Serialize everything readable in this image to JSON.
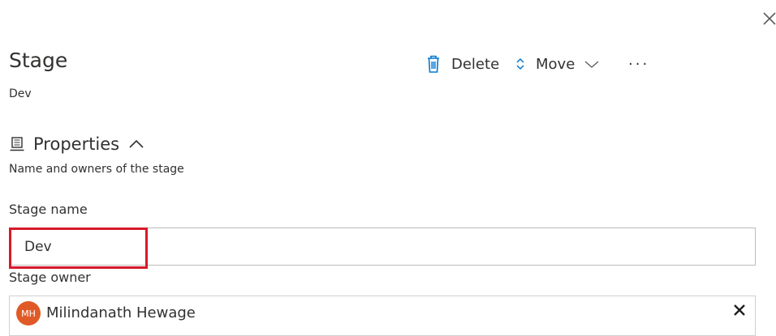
{
  "panel": {
    "title": "Stage",
    "subtitle": "Dev"
  },
  "toolbar": {
    "delete_label": "Delete",
    "move_label": "Move",
    "more_label": "···"
  },
  "properties": {
    "label": "Properties",
    "description": "Name and owners of the stage"
  },
  "stage_name": {
    "label": "Stage name",
    "value": "Dev"
  },
  "stage_owner": {
    "label": "Stage owner",
    "initials": "MH",
    "name": "Milindanath Hewage"
  },
  "colors": {
    "highlight": "#d7192a",
    "avatar": "#e05a28"
  },
  "icons": [
    "close-icon",
    "trash-icon",
    "sort-icon",
    "chevron-down-icon",
    "properties-icon",
    "chevron-up-icon",
    "remove-icon"
  ]
}
